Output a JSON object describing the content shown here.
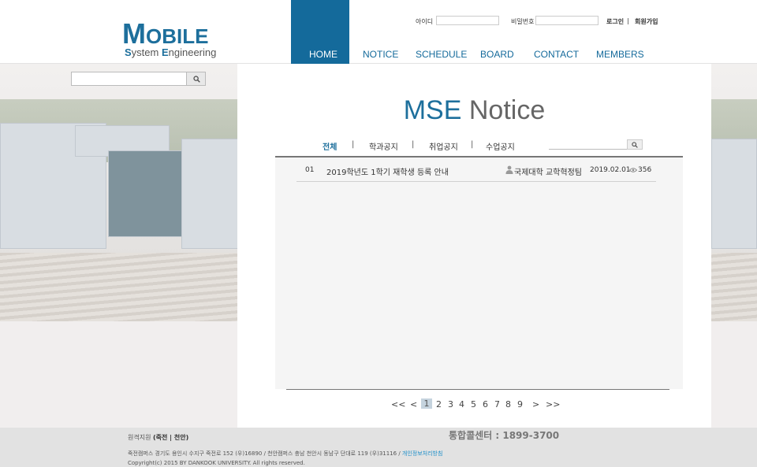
{
  "header": {
    "logo": {
      "main_first": "M",
      "main_rest": "OBILE",
      "sub_s": "S",
      "sub_ystem": "ystem ",
      "sub_e": "E",
      "sub_ngineering": "ngineering"
    },
    "login": {
      "id_label": "아이디",
      "pw_label": "비밀번호",
      "login_link": "로그인",
      "divider": "|",
      "signup_link": "회원가입"
    },
    "nav": [
      "HOME",
      "NOTICE",
      "SCHEDULE",
      "BOARD",
      "CONTACT",
      "MEMBERS"
    ],
    "active_nav": "HOME",
    "accent_color": "#146a9b"
  },
  "side_search": {
    "value": "",
    "icon": "search-icon"
  },
  "main": {
    "title_highlight": "MSE",
    "title_rest": " Notice",
    "tabs": [
      "전체",
      "학과공지",
      "취업공지",
      "수업공지"
    ],
    "tab_separator": "|",
    "active_tab": "전체",
    "search": {
      "value": "",
      "icon": "search-icon"
    },
    "rows": [
      {
        "num": "01",
        "title": "2019학년도 1학기 재학생 등록 안내",
        "author": "국제대학 교학혁정팀",
        "date": "2019.02.01",
        "views": "356"
      }
    ],
    "pagination": {
      "first": "<<",
      "prev": "<",
      "pages": [
        "1",
        "2",
        "3",
        "4",
        "5",
        "6",
        "7",
        "8",
        "9"
      ],
      "current": "1",
      "next": ">",
      "last": ">>"
    }
  },
  "footer": {
    "campus_label": "원격지원",
    "campus_links": "(죽전 | 천안)",
    "call_center": "통합콜센터 : 1899-3700",
    "address": "죽전캠퍼스 경기도 용인시 수지구 죽전로 152 (우)16890 / 천안캠퍼스 충남 천안시 동남구 단대로 119 (우)31116 /",
    "privacy_link": "개인정보처리방침",
    "copyright": "Copyright(c) 2015 BY DANKOOK UNIVERSITY. All rights reserved."
  }
}
